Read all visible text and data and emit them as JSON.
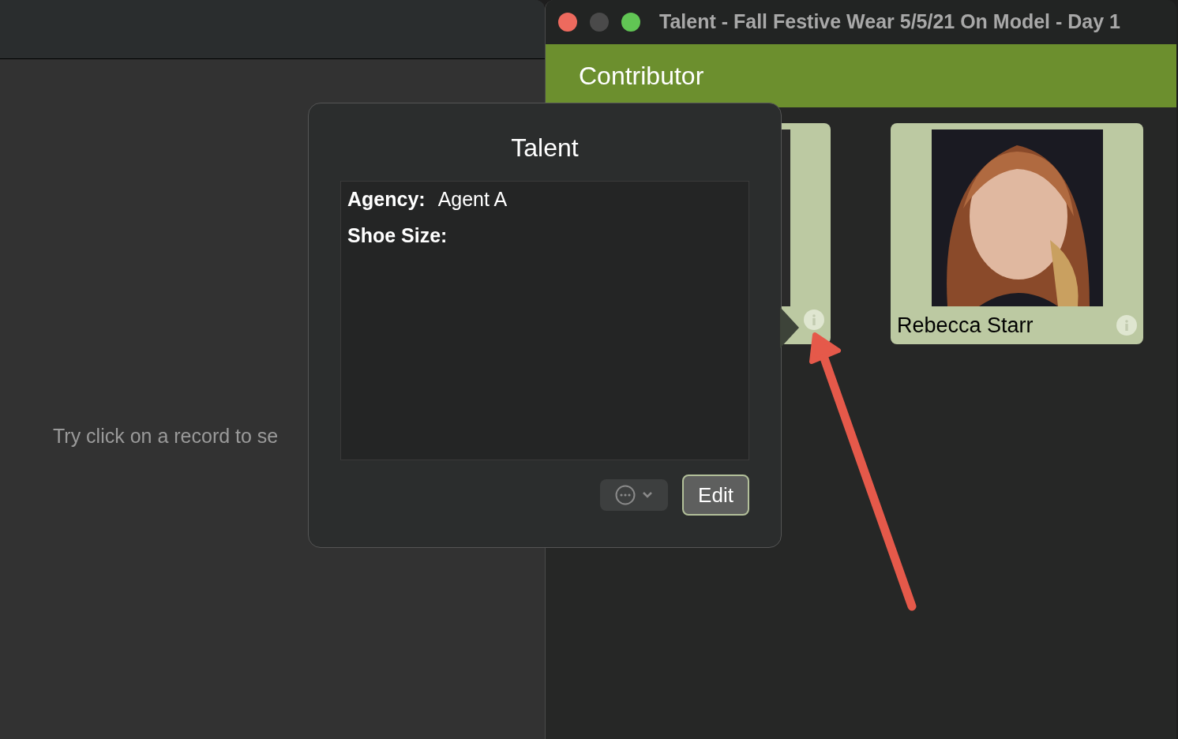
{
  "left_window": {
    "hint": "Try click on a record to se"
  },
  "window": {
    "title": "Talent - Fall Festive Wear 5/5/21 On Model - Day 1",
    "traffic_lights": [
      {
        "color": "#ed6a5e"
      },
      {
        "color": "#4a4a4a"
      },
      {
        "color": "#61c554"
      }
    ]
  },
  "header": {
    "title": "Contributor"
  },
  "cards": [
    {
      "kind": "covered"
    },
    {
      "kind": "full",
      "name": "Rebecca Starr"
    }
  ],
  "popover": {
    "title": "Talent",
    "fields": [
      {
        "label": "Agency:",
        "value": "Agent A"
      },
      {
        "label": "Shoe Size:"
      }
    ],
    "edit_button": "Edit"
  }
}
